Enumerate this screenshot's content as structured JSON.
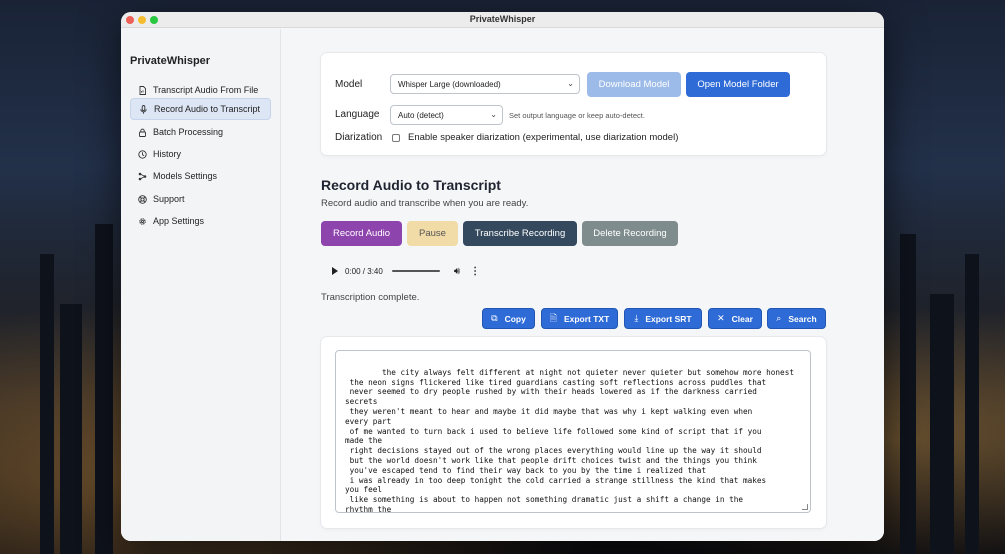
{
  "window": {
    "title": "PrivateWhisper"
  },
  "sidebar": {
    "app_name": "PrivateWhisper",
    "items": [
      {
        "label": "Transcript Audio From File",
        "icon": "file-audio-icon"
      },
      {
        "label": "Record Audio to Transcript",
        "icon": "microphone-icon",
        "active": true
      },
      {
        "label": "Batch Processing",
        "icon": "lock-icon"
      },
      {
        "label": "History",
        "icon": "history-icon"
      },
      {
        "label": "Models Settings",
        "icon": "models-icon"
      },
      {
        "label": "Support",
        "icon": "support-icon"
      },
      {
        "label": "App Settings",
        "icon": "gear-icon"
      }
    ]
  },
  "settings": {
    "model_label": "Model",
    "model_value": "Whisper Large (downloaded)",
    "download_model": "Download Model",
    "open_model_folder": "Open Model Folder",
    "language_label": "Language",
    "language_value": "Auto (detect)",
    "language_hint": "Set output language or keep auto-detect.",
    "diarization_label": "Diarization",
    "diarization_checkbox": "Enable speaker diarization (experimental, use diarization model)",
    "diarization_checked": false
  },
  "record": {
    "title": "Record Audio to Transcript",
    "subtitle": "Record audio and transcribe when you are ready.",
    "buttons": {
      "record": "Record Audio",
      "pause": "Pause",
      "transcribe": "Transcribe Recording",
      "delete": "Delete Recording"
    },
    "player_time": "0:00 / 3:40",
    "status": "Transcription complete."
  },
  "actions": {
    "copy": "Copy",
    "export_txt": "Export TXT",
    "export_srt": "Export SRT",
    "clear": "Clear",
    "search": "Search"
  },
  "transcript": {
    "text": "the city always felt different at night not quieter never quieter but somehow more honest\n the neon signs flickered like tired guardians casting soft reflections across puddles that\n never seemed to dry people rushed by with their heads lowered as if the darkness carried\nsecrets\n they weren't meant to hear and maybe it did maybe that was why i kept walking even when\nevery part\n of me wanted to turn back i used to believe life followed some kind of script that if you\nmade the\n right decisions stayed out of the wrong places everything would line up the way it should\n but the world doesn't work like that people drift choices twist and the things you think\n you've escaped tend to find their way back to you by the time i realized that\n i was already in too deep tonight the cold carried a strange stillness the kind that makes\nyou feel\n like something is about to happen not something dramatic just a shift a change in the\nrhythm the\n kind of moment most people miss but i notice those things i always have maybe that's why i"
  },
  "colors": {
    "record": "#8e44ad",
    "pause": "#f1dca8",
    "transcribe": "#34495e",
    "delete": "#7f8c8d",
    "primary": "#2e6bd6",
    "download_disabled": "#9dbbe8"
  }
}
